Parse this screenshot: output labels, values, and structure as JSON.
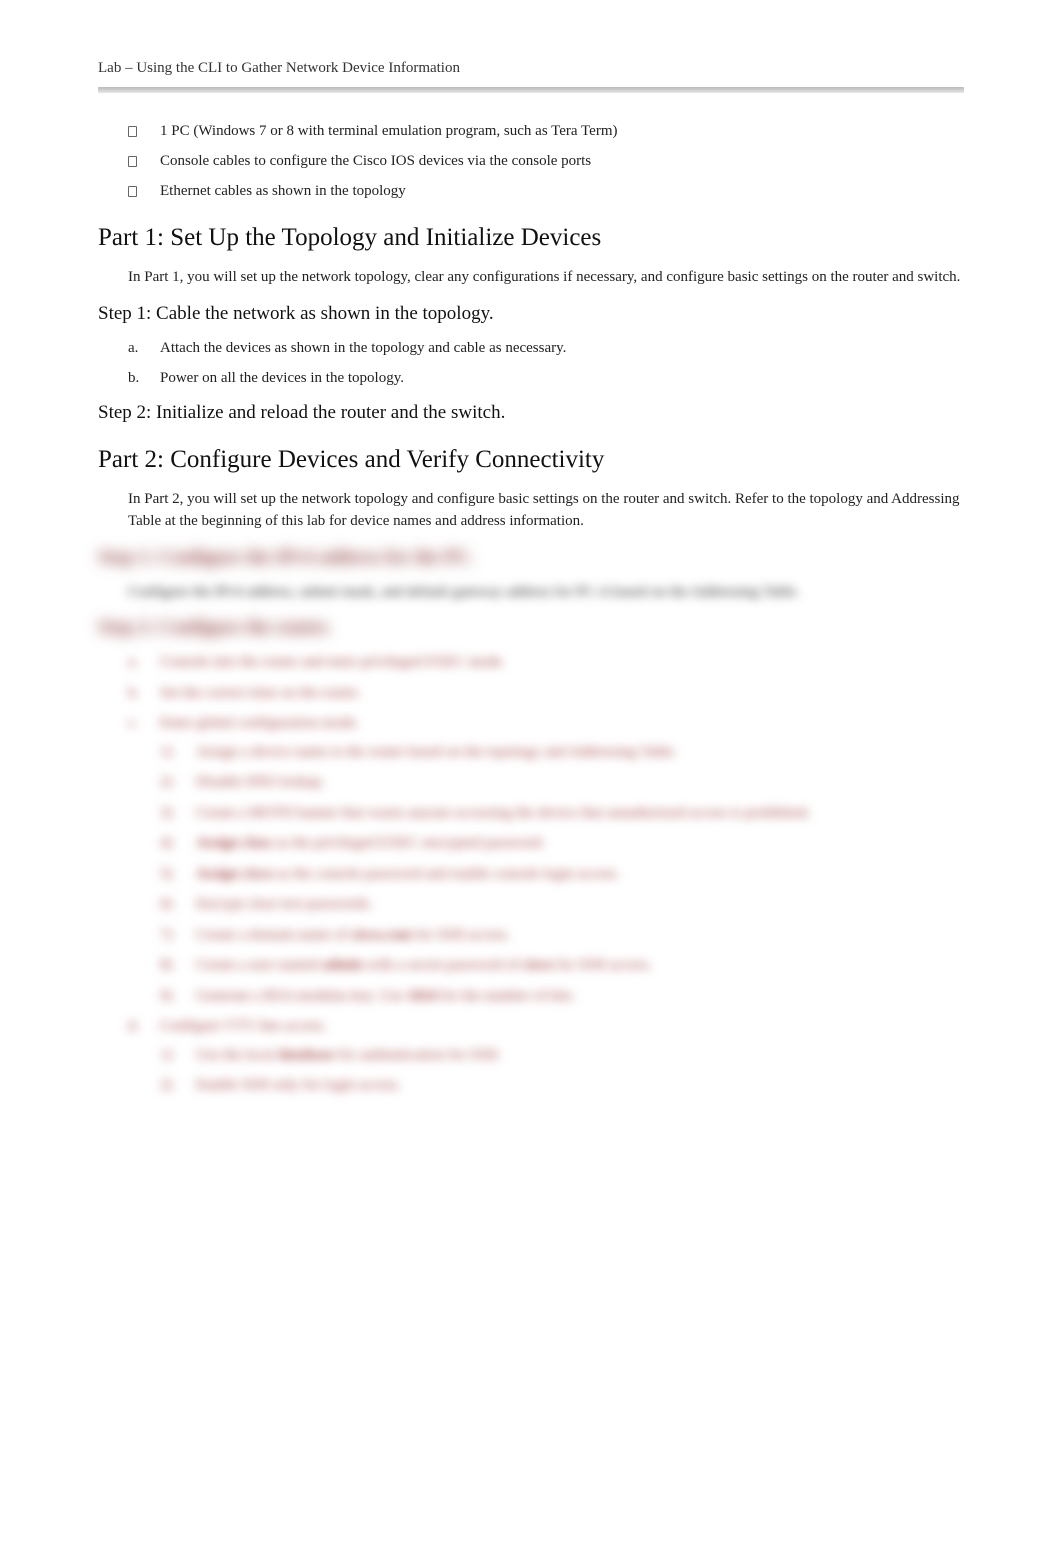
{
  "header": {
    "title": "Lab  –  Using the CLI to Gather Network Device Information"
  },
  "equipment": [
    "1 PC (Windows 7 or 8 with terminal emulation program, such as Tera Term)",
    "Console cables to configure the Cisco IOS devices via the console ports",
    "Ethernet cables as shown in the topology"
  ],
  "part1": {
    "heading": "Part 1: Set Up the Topology and Initialize Devices",
    "intro": "In Part 1, you will set up the network topology, clear any configurations if necessary, and configure basic settings on the router and switch.",
    "step1": {
      "heading": "Step 1: Cable the network as shown in the topology.",
      "items": [
        {
          "marker": "a.",
          "text": "Attach the devices as shown in the topology and cable as necessary."
        },
        {
          "marker": "b.",
          "text": "Power on all the devices in the topology."
        }
      ]
    },
    "step2": {
      "heading": "Step 2: Initialize and reload the router and the switch."
    }
  },
  "part2": {
    "heading": "Part 2: Configure Devices and Verify Connectivity",
    "intro": "In Part 2, you will set up the network topology and configure basic settings on the router and switch. Refer to the topology and Addressing Table at the beginning of this lab for device names and address information.",
    "step1": {
      "heading": "Step 1: Configure the IPv4 address for the PC.",
      "text": "Configure the IPv4 address, subnet mask, and default gateway address for PC-A based on the Addressing Table."
    },
    "step2": {
      "heading": "Step 2: Configure the router.",
      "items": [
        {
          "marker": "a.",
          "text": "Console into the router and enter privileged EXEC mode."
        },
        {
          "marker": "b.",
          "text": "Set the correct time on the router."
        },
        {
          "marker": "c.",
          "text": "Enter global configuration mode.",
          "sub": [
            {
              "n": "1)",
              "text": "Assign a device name to the router based on the topology and Addressing Table."
            },
            {
              "n": "2)",
              "text": "Disable DNS lookup."
            },
            {
              "n": "3)",
              "text": "Create a MOTD banner that warns anyone accessing the device that unauthorized access is prohibited."
            },
            {
              "n": "4)",
              "text": "Assign class as the privileged EXEC encrypted password."
            },
            {
              "n": "5)",
              "text": "Assign cisco as the console password and enable console login access."
            },
            {
              "n": "6)",
              "text": "Encrypt clear text passwords."
            },
            {
              "n": "7)",
              "text": "Create a domain name of cisco.com for SSH access."
            },
            {
              "n": "8)",
              "text": "Create a user named admin with a secret password of cisco for SSH access."
            },
            {
              "n": "9)",
              "text": "Generate a RSA modulus key. Use 1024 for the number of bits."
            }
          ]
        },
        {
          "marker": "d.",
          "text": "Configure VTY line access.",
          "sub": [
            {
              "n": "1)",
              "text": "Use the local database for authentication for SSH."
            },
            {
              "n": "2)",
              "text": "Enable SSH only for login access."
            }
          ]
        }
      ]
    }
  }
}
